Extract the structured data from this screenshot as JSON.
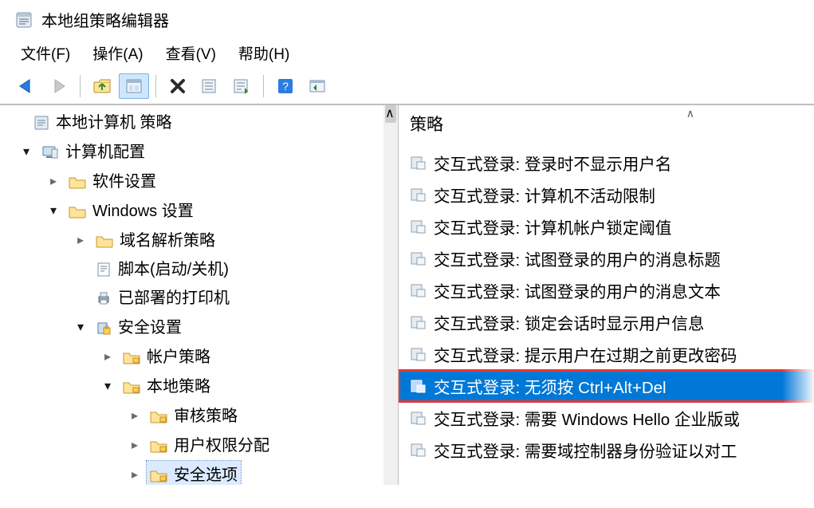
{
  "window": {
    "title": "本地组策略编辑器"
  },
  "menu": {
    "file": "文件(F)",
    "action": "操作(A)",
    "view": "查看(V)",
    "help": "帮助(H)"
  },
  "toolbar_icons": {
    "back": "back-arrow-icon",
    "forward": "forward-arrow-icon",
    "up": "folder-up-icon",
    "props": "properties-icon",
    "delete": "delete-icon",
    "export": "export-list-icon",
    "refresh": "refresh-icon",
    "helpq": "help-icon",
    "display": "show-pane-icon"
  },
  "tree": {
    "root": "本地计算机 策略",
    "computer_config": "计算机配置",
    "software_settings": "软件设置",
    "windows_settings": "Windows 设置",
    "dns_policy": "域名解析策略",
    "scripts": "脚本(启动/关机)",
    "deployed_printers": "已部署的打印机",
    "security_settings": "安全设置",
    "account_policy": "帐户策略",
    "local_policy": "本地策略",
    "audit_policy": "审核策略",
    "user_rights": "用户权限分配",
    "security_options": "安全选项"
  },
  "policy": {
    "header": "策略",
    "items": [
      "交互式登录: 登录时不显示用户名",
      "交互式登录: 计算机不活动限制",
      "交互式登录: 计算机帐户锁定阈值",
      "交互式登录: 试图登录的用户的消息标题",
      "交互式登录: 试图登录的用户的消息文本",
      "交互式登录: 锁定会话时显示用户信息",
      "交互式登录: 提示用户在过期之前更改密码",
      "交互式登录: 无须按 Ctrl+Alt+Del",
      "交互式登录: 需要 Windows Hello 企业版或",
      "交互式登录: 需要域控制器身份验证以对工"
    ],
    "selected_index": 7
  }
}
